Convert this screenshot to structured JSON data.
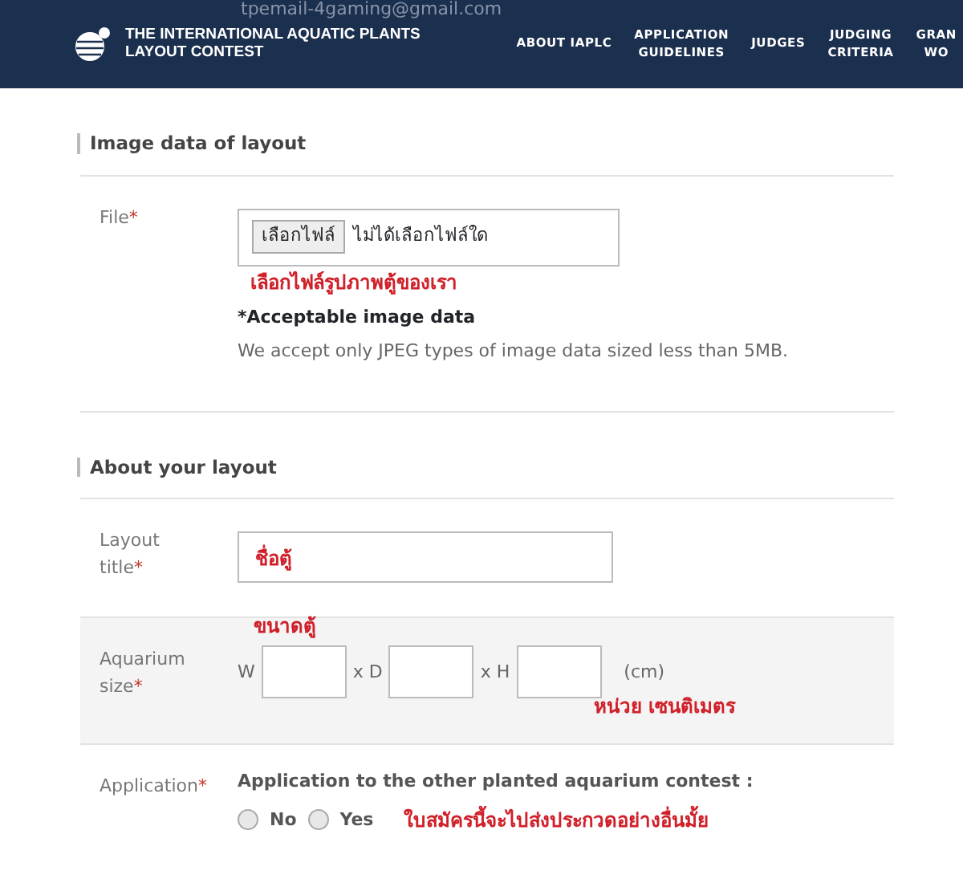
{
  "overlay_text": "tpemail-4gaming@gmail.com",
  "header": {
    "logo_lines": [
      "THE INTERNATIONAL AQUATIC PLANTS",
      "LAYOUT CONTEST"
    ],
    "nav": [
      {
        "lines": [
          "ABOUT IAPLC"
        ]
      },
      {
        "lines": [
          "APPLICATION",
          "GUIDELINES"
        ]
      },
      {
        "lines": [
          "JUDGES"
        ]
      },
      {
        "lines": [
          "JUDGING",
          "CRITERIA"
        ]
      },
      {
        "lines": [
          "GRAN",
          "WO"
        ]
      }
    ]
  },
  "sections": [
    {
      "title": "Image data of layout",
      "rows": [
        {
          "kind": "file",
          "label": "File",
          "required_mark": "*",
          "button": "เลือกไฟล์",
          "status": "ไม่ได้เลือกไฟล์ใด",
          "annotation": "เลือกไฟล์รูปภาพตู้ของเรา",
          "note_title": "*Acceptable image data",
          "note": "We accept only JPEG types of image data sized less than 5MB."
        }
      ]
    },
    {
      "title": "About your layout",
      "rows": [
        {
          "kind": "text",
          "label": "Layout title",
          "required_mark": "*",
          "value": "ชื่อตู้"
        },
        {
          "kind": "size",
          "label": "Aquarium size",
          "required_mark": "*",
          "annotation_top": "ขนาดตู้",
          "dims": [
            "W",
            "x D",
            "x H"
          ],
          "unit": "(cm)",
          "annotation_bottom": "หน่วย เซนติเมตร"
        },
        {
          "kind": "radio",
          "label": "Application",
          "required_mark": "*",
          "question": "Application to the other planted aquarium contest :",
          "options": [
            {
              "label": "No",
              "selected": false
            },
            {
              "label": "Yes",
              "selected": false
            }
          ],
          "annotation": "ใบสมัครนี้จะไปส่งประกวดอย่างอื่นมั้ย"
        }
      ]
    }
  ]
}
